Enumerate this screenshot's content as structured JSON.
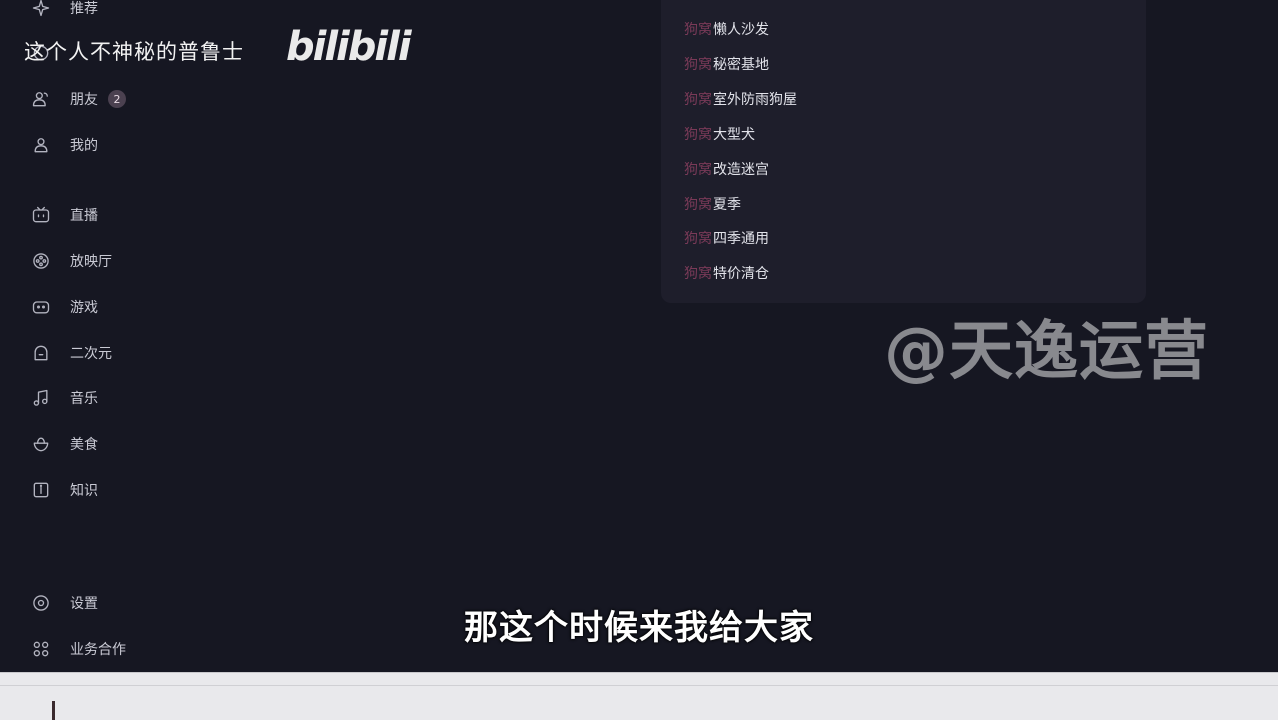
{
  "sidebar": {
    "items": [
      {
        "label": "推荐",
        "icon": "sparkle-icon"
      },
      {
        "label": "",
        "icon": "compass-icon"
      },
      {
        "label": "朋友",
        "icon": "friends-icon",
        "badge": "2"
      },
      {
        "label": "我的",
        "icon": "user-icon"
      },
      {
        "label": "直播",
        "icon": "tv-icon"
      },
      {
        "label": "放映厅",
        "icon": "film-reel-icon"
      },
      {
        "label": "游戏",
        "icon": "gamepad-icon"
      },
      {
        "label": "二次元",
        "icon": "ghost-icon"
      },
      {
        "label": "音乐",
        "icon": "music-note-icon"
      },
      {
        "label": "美食",
        "icon": "bowl-icon"
      },
      {
        "label": "知识",
        "icon": "book-icon"
      },
      {
        "label": "设置",
        "icon": "gear-icon"
      },
      {
        "label": "业务合作",
        "icon": "grid-icon"
      }
    ]
  },
  "dropdown": {
    "tag": "狗窝",
    "items": [
      "懒人沙发",
      "秘密基地",
      "室外防雨狗屋",
      "大型犬",
      "改造迷宫",
      "夏季",
      "四季通用",
      "特价清仓"
    ]
  },
  "overlay": {
    "uploader": "这个人不神秘的普鲁士",
    "platform_logo": "bilibili",
    "brand_watermark": "@天逸运营",
    "subtitle": "那这个时候来我给大家"
  },
  "colors": {
    "background": "#161722",
    "panel": "#1e1e2b",
    "tag": "#7a3a58"
  }
}
